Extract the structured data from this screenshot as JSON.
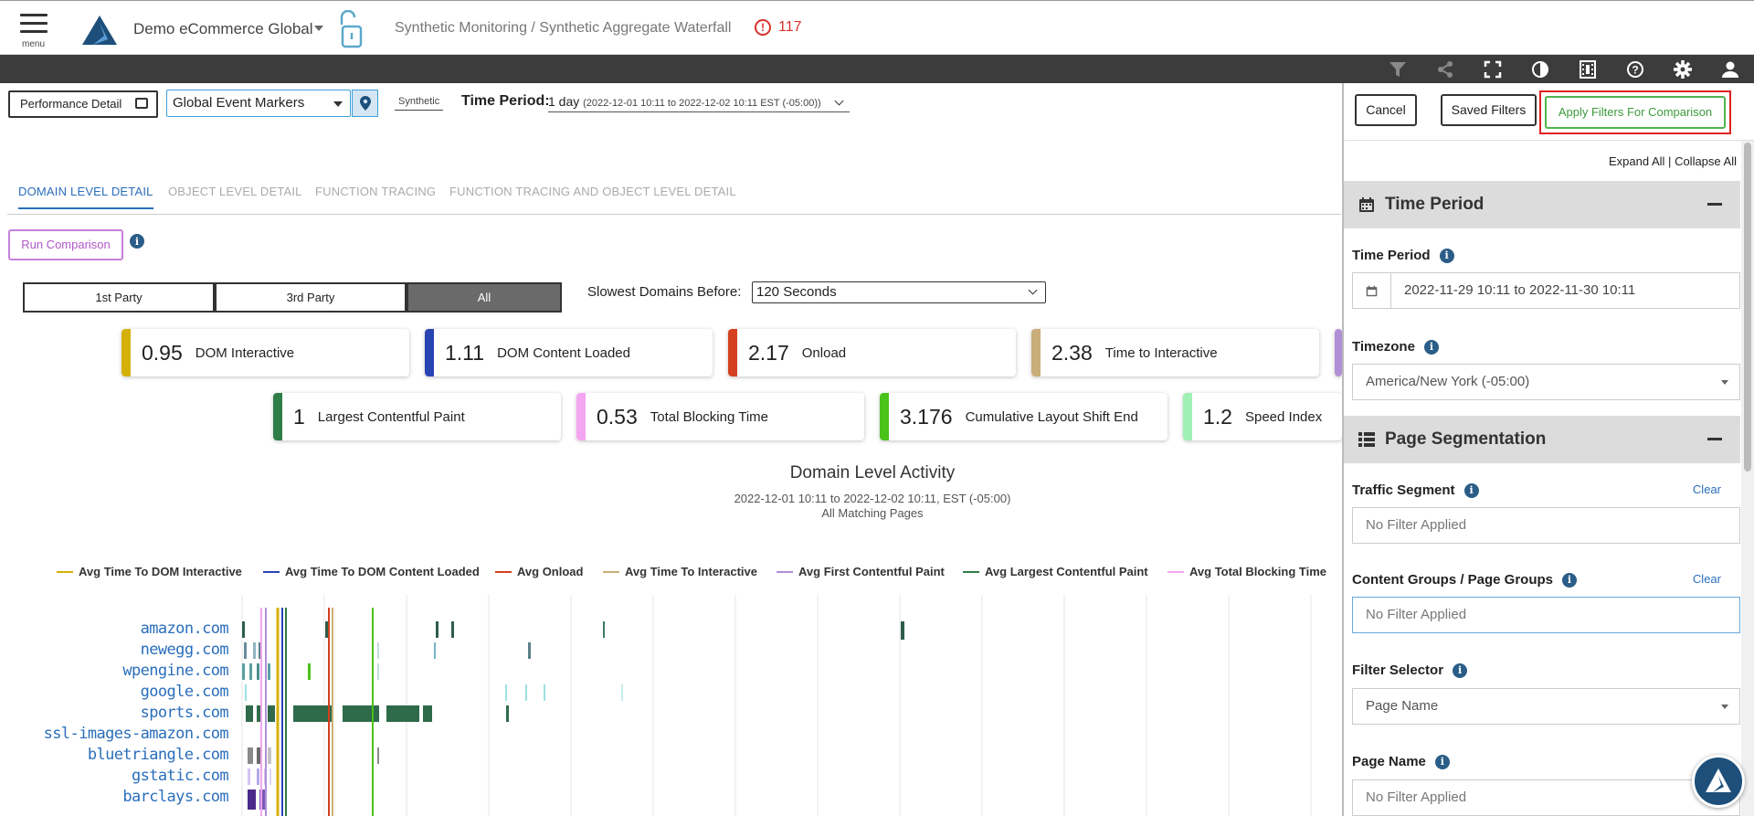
{
  "header": {
    "menu_label": "menu",
    "org_name": "Demo eCommerce Global",
    "breadcrumb": "Synthetic Monitoring / Synthetic Aggregate Waterfall",
    "alert_count": "117"
  },
  "toolbar_icons": [
    "filter-icon",
    "share-icon",
    "fullscreen-icon",
    "contrast-icon",
    "film-icon",
    "help-icon",
    "settings-icon",
    "user-icon"
  ],
  "controls": {
    "performance_detail_label": "Performance Detail",
    "event_markers_value": "Global Event Markers",
    "synthetic_tag": "Synthetic",
    "time_period_label": "Time Period:",
    "time_period_value": "1 day",
    "time_period_range": "(2022-12-01 10:11 to 2022-12-02 10:11 EST (-05:00))"
  },
  "tabs": [
    {
      "label": "DOMAIN LEVEL DETAIL",
      "active": true
    },
    {
      "label": "OBJECT LEVEL DETAIL",
      "active": false
    },
    {
      "label": "FUNCTION TRACING",
      "active": false
    },
    {
      "label": "FUNCTION TRACING AND OBJECT LEVEL DETAIL",
      "active": false
    }
  ],
  "run_comparison_label": "Run Comparison",
  "party_filter": {
    "options": [
      "1st Party",
      "3rd Party",
      "All"
    ],
    "selected": "All"
  },
  "slowest_domains": {
    "label": "Slowest Domains Before:",
    "value": "120 Seconds"
  },
  "metrics": [
    {
      "value": "0.95",
      "name": "DOM Interactive",
      "color": "#d4b106"
    },
    {
      "value": "1.11",
      "name": "DOM Content Loaded",
      "color": "#2944b3"
    },
    {
      "value": "2.17",
      "name": "Onload",
      "color": "#d4401f"
    },
    {
      "value": "2.38",
      "name": "Time to Interactive",
      "color": "#c9ae79"
    },
    {
      "value": "",
      "name": "",
      "color": "#b18fd6"
    },
    {
      "value": "1",
      "name": "Largest Contentful Paint",
      "color": "#2e7d46"
    },
    {
      "value": "0.53",
      "name": "Total Blocking Time",
      "color": "#f4a6f0"
    },
    {
      "value": "3.176",
      "name": "Cumulative Layout Shift End",
      "color": "#49c21a"
    },
    {
      "value": "1.2",
      "name": "Speed Index",
      "color": "#9ef0b4"
    }
  ],
  "chart": {
    "title": "Domain Level Activity",
    "subtitle_line1": "2022-12-01 10:11 to 2022-12-02 10:11, EST (-05:00)",
    "subtitle_line2": "All Matching Pages"
  },
  "chart_data": {
    "type": "table",
    "legend": [
      {
        "name": "Avg Time To DOM Interactive",
        "color": "#d4b106"
      },
      {
        "name": "Avg Time To DOM Content Loaded",
        "color": "#2944b3"
      },
      {
        "name": "Avg Onload",
        "color": "#d4401f"
      },
      {
        "name": "Avg Time To Interactive",
        "color": "#c9ae79"
      },
      {
        "name": "Avg First Contentful Paint",
        "color": "#b18fd6"
      },
      {
        "name": "Avg Largest Contentful Paint",
        "color": "#2e7d46"
      },
      {
        "name": "Avg Total Blocking Time",
        "color": "#f4a6f0"
      }
    ],
    "domains": [
      "amazon.com",
      "newegg.com",
      "wpengine.com",
      "google.com",
      "sports.com",
      "ssl-images-amazon.com",
      "bluetriangle.com",
      "gstatic.com",
      "barclays.com"
    ]
  },
  "filter_panel": {
    "cancel_label": "Cancel",
    "saved_filters_label": "Saved Filters",
    "apply_label": "Apply Filters For Comparison",
    "expand_all": "Expand All",
    "separator": "|",
    "collapse_all": "Collapse All",
    "time_section_title": "Time Period",
    "time_period_label": "Time Period",
    "time_period_value": "2022-11-29 10:11 to 2022-11-30 10:11",
    "timezone_label": "Timezone",
    "timezone_value": "America/New York (-05:00)",
    "segmentation_title": "Page Segmentation",
    "traffic_segment_label": "Traffic Segment",
    "clear_label": "Clear",
    "content_groups_label": "Content Groups / Page Groups",
    "filter_selector_label": "Filter Selector",
    "filter_selector_value": "Page Name",
    "page_name_label": "Page Name",
    "no_filter": "No Filter Applied"
  }
}
